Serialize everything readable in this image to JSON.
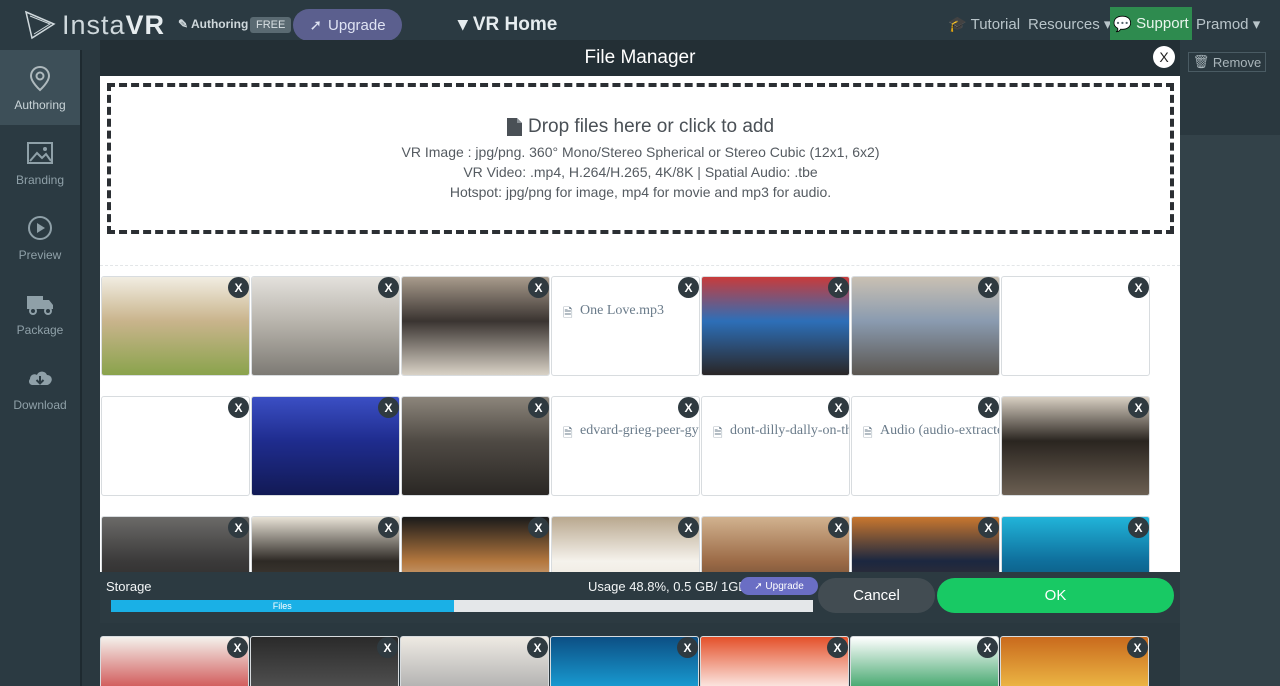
{
  "app": {
    "logo_text_light": "Insta",
    "logo_text_bold": "VR",
    "authoring_label": "Authoring",
    "free_badge": "FREE",
    "upgrade_label": "Upgrade",
    "project_title": "VR Home",
    "tutorial_label": "Tutorial",
    "resources_label": "Resources",
    "support_label": "Support",
    "user_label": "Pramod",
    "remove_label": "Remove"
  },
  "sidebar": {
    "items": [
      {
        "label": "Authoring",
        "icon": "map-pin-icon"
      },
      {
        "label": "Branding",
        "icon": "image-icon"
      },
      {
        "label": "Preview",
        "icon": "play-icon"
      },
      {
        "label": "Package",
        "icon": "truck-icon"
      },
      {
        "label": "Download",
        "icon": "cloud-download-icon"
      }
    ]
  },
  "modal": {
    "title": "File Manager",
    "close_label": "X",
    "dropzone": {
      "title": "Drop files here or click to add",
      "line1": "VR Image : jpg/png. 360° Mono/Stereo Spherical or Stereo Cubic (12x1, 6x2)",
      "line2": "VR Video: .mp4, H.264/H.265, 4K/8K | Spatial Audio: .tbe",
      "line3": "Hotspot: jpg/png for image, mp4 for movie and mp3 for audio."
    },
    "tile_remove_label": "X",
    "files": [
      {
        "type": "image",
        "name": "",
        "colors": [
          "#c9b48c",
          "#f1ede2",
          "#8aa34c"
        ]
      },
      {
        "type": "image",
        "name": "",
        "colors": [
          "#b9b5ad",
          "#e3e1dc",
          "#7d7a74"
        ]
      },
      {
        "type": "image",
        "name": "",
        "colors": [
          "#3a3431",
          "#a89b8c",
          "#d9d2c6"
        ]
      },
      {
        "type": "audio",
        "name": "One Love.mp3",
        "colors": [
          "#ffffff",
          "#ffffff",
          "#ffffff"
        ]
      },
      {
        "type": "image",
        "name": "",
        "colors": [
          "#2d6fb8",
          "#c83b3b",
          "#2a2626"
        ]
      },
      {
        "type": "image",
        "name": "",
        "colors": [
          "#8a9bb0",
          "#c9c0b2",
          "#5b5650"
        ]
      },
      {
        "type": "blank",
        "name": "",
        "colors": [
          "#ffffff",
          "#ffffff",
          "#ffffff"
        ]
      },
      {
        "type": "blank",
        "name": "",
        "colors": [
          "#ffffff",
          "#ffffff",
          "#ffffff"
        ]
      },
      {
        "type": "image",
        "name": "",
        "colors": [
          "#1f2c8e",
          "#3b4fc4",
          "#121a55"
        ]
      },
      {
        "type": "image",
        "name": "",
        "colors": [
          "#4f4a44",
          "#8c857b",
          "#2a2724"
        ]
      },
      {
        "type": "audio",
        "name": "edvard-grieg-peer-gy",
        "colors": [
          "#ffffff",
          "#ffffff",
          "#ffffff"
        ]
      },
      {
        "type": "audio",
        "name": "dont-dilly-dally-on-th",
        "colors": [
          "#ffffff",
          "#ffffff",
          "#ffffff"
        ]
      },
      {
        "type": "audio",
        "name": "Audio (audio-extracte",
        "colors": [
          "#ffffff",
          "#ffffff",
          "#ffffff"
        ]
      },
      {
        "type": "image",
        "name": "",
        "colors": [
          "#2a2520",
          "#d8cfc2",
          "#6b5f52"
        ]
      },
      {
        "type": "image",
        "name": "",
        "colors": [
          "#3b3a3a",
          "#6b6a68",
          "#1f1e1d"
        ]
      },
      {
        "type": "image",
        "name": "",
        "colors": [
          "#2e2a25",
          "#e8e2d6",
          "#5a534a"
        ]
      },
      {
        "type": "image",
        "name": "",
        "colors": [
          "#b3773e",
          "#1a1a1a",
          "#efe9df"
        ]
      },
      {
        "type": "image",
        "name": "",
        "colors": [
          "#f5f2ec",
          "#b9a88f",
          "#e4dccd"
        ]
      },
      {
        "type": "image",
        "name": "",
        "colors": [
          "#9c6b47",
          "#d1b28f",
          "#3a2a20"
        ]
      },
      {
        "type": "image",
        "name": "",
        "colors": [
          "#1b2740",
          "#c9772e",
          "#5a3a24"
        ]
      },
      {
        "type": "image",
        "name": "",
        "colors": [
          "#0f6f9c",
          "#21b4d9",
          "#0a3e58"
        ]
      }
    ],
    "storage": {
      "label": "Storage",
      "usage_text": "Usage 48.8%, 0.5 GB/ 1GB",
      "upgrade_label": "Upgrade",
      "bar_label": "Files",
      "fraction": 0.488
    },
    "cancel_label": "Cancel",
    "ok_label": "OK"
  },
  "below_row": [
    {
      "colors": [
        "#f4f1ec",
        "#c44"
      ]
    },
    {
      "colors": [
        "#2a2a2a",
        "#555"
      ]
    },
    {
      "colors": [
        "#eeeae3",
        "#aaa"
      ]
    },
    {
      "colors": [
        "#0c4f84",
        "#1aa6dd"
      ]
    },
    {
      "colors": [
        "#e4512a",
        "#ffffff"
      ]
    },
    {
      "colors": [
        "#ffffff",
        "#2b9b5a"
      ]
    },
    {
      "colors": [
        "#c96a1d",
        "#f1c14a"
      ]
    }
  ]
}
